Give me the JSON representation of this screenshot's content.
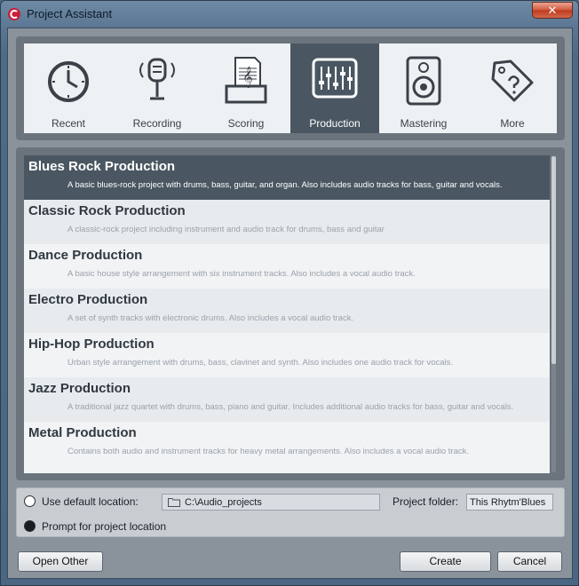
{
  "window": {
    "title": "Project Assistant",
    "close_label": "✕"
  },
  "categories": [
    {
      "label": "Recent",
      "icon": "clock-icon",
      "active": false
    },
    {
      "label": "Recording",
      "icon": "microphone-icon",
      "active": false
    },
    {
      "label": "Scoring",
      "icon": "sheet-music-icon",
      "active": false
    },
    {
      "label": "Production",
      "icon": "mixer-faders-icon",
      "active": true
    },
    {
      "label": "Mastering",
      "icon": "speaker-icon",
      "active": false
    },
    {
      "label": "More",
      "icon": "tag-icon",
      "active": false
    }
  ],
  "templates": [
    {
      "title": "Blues Rock Production",
      "description": "A basic blues-rock project with drums, bass, guitar, and organ. Also includes audio tracks for bass, guitar and vocals.",
      "selected": true
    },
    {
      "title": "Classic Rock Production",
      "description": "A classic-rock project including instrument and audio track for drums, bass and guitar",
      "selected": false
    },
    {
      "title": "Dance Production",
      "description": "A basic house style arrangement with six instrument tracks. Also includes a vocal audio track.",
      "selected": false
    },
    {
      "title": "Electro Production",
      "description": "A set of synth tracks with electronic drums. Also includes a vocal audio track.",
      "selected": false
    },
    {
      "title": "Hip-Hop Production",
      "description": "Urban style arrangement with drums, bass, clavinet and synth. Also includes one audio track for vocals.",
      "selected": false
    },
    {
      "title": "Jazz Production",
      "description": "A traditional jazz quartet with drums, bass, piano and guitar. Includes additional audio tracks for bass, guitar and vocals.",
      "selected": false
    },
    {
      "title": "Metal Production",
      "description": "Contains both audio and instrument tracks for heavy metal arrangements. Also includes a vocal audio track.",
      "selected": false
    }
  ],
  "location": {
    "default_label": "Use default location:",
    "default_path": "C:\\Audio_projects",
    "project_folder_label": "Project folder:",
    "project_folder_value": "This Rhytm'Blues",
    "prompt_label": "Prompt for project location",
    "selected_option": "prompt"
  },
  "buttons": {
    "open_other": "Open Other",
    "create": "Create",
    "cancel": "Cancel"
  }
}
